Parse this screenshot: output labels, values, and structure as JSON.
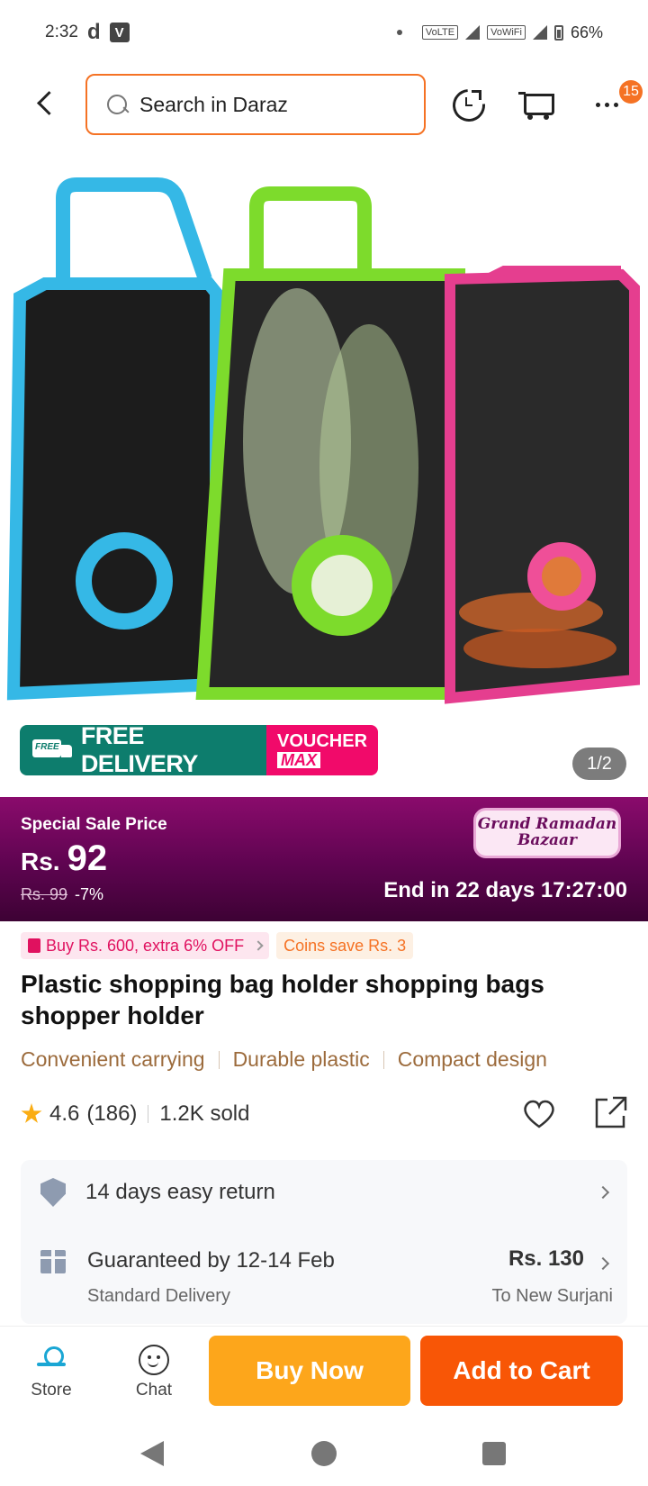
{
  "status_bar": {
    "time": "2:32",
    "app_icon_1": "d",
    "app_icon_2": "V",
    "volte": "VoLTE",
    "vowifi": "VoWiFi",
    "battery": "66%"
  },
  "header": {
    "search_placeholder": "Search in Daraz",
    "badge_count": "15"
  },
  "gallery": {
    "counter": "1/2",
    "free_delivery": "FREE DELIVERY",
    "free_tag": "FREE",
    "voucher": "VOUCHER",
    "voucher_max": "MAX",
    "bag_colors": [
      "#35b8e6",
      "#7ddb2c",
      "#e53e8f"
    ]
  },
  "sale": {
    "label": "Special Sale Price",
    "currency": "Rs.",
    "price": "92",
    "old_price": "Rs. 99",
    "discount": "-7%",
    "campaign_line1": "Grand Ramadan",
    "campaign_line2": "Bazaar",
    "countdown": "End in 22 days 17:27:00"
  },
  "promos": {
    "spend_offer": "Buy Rs. 600, extra 6% OFF",
    "coins": "Coins save Rs. 3"
  },
  "product": {
    "title": "Plastic shopping bag holder shopping bags shopper holder",
    "features": [
      "Convenient carrying",
      "Durable plastic",
      "Compact design"
    ],
    "rating": "4.6",
    "reviews": "(186)",
    "sold": "1.2K sold"
  },
  "services": {
    "return_policy": "14 days easy return",
    "delivery_title": "Guaranteed by 12-14 Feb",
    "delivery_type": "Standard Delivery",
    "delivery_price": "Rs. 130",
    "delivery_location": "To New Surjani"
  },
  "bottom_bar": {
    "store_label": "Store",
    "chat_label": "Chat",
    "buy_now": "Buy Now",
    "add_to_cart": "Add to Cart"
  },
  "colors": {
    "accent": "#f57224",
    "buy_now": "#fda61b",
    "add_to_cart": "#f85606",
    "sale_banner": "#6a0a5e"
  }
}
